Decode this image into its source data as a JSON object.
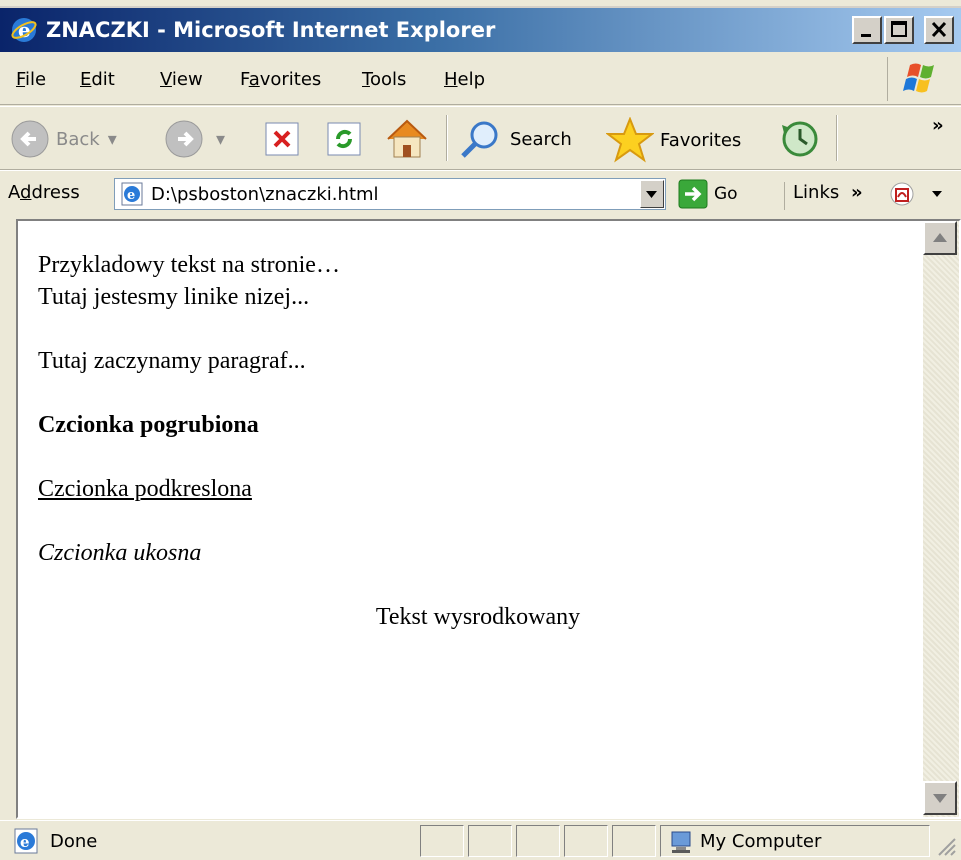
{
  "window": {
    "title": "ZNACZKI - Microsoft Internet Explorer"
  },
  "menu": {
    "items": [
      {
        "label_acc": "F",
        "label_rest": "ile"
      },
      {
        "label_acc": "E",
        "label_rest": "dit"
      },
      {
        "label_acc": "V",
        "label_rest": "iew"
      },
      {
        "label_pre": "F",
        "label_acc": "a",
        "label_rest": "vorites"
      },
      {
        "label_acc": "T",
        "label_rest": "ools"
      },
      {
        "label_acc": "H",
        "label_rest": "elp"
      }
    ]
  },
  "toolbar": {
    "back_label": "Back",
    "search_label": "Search",
    "favorites_label": "Favorites",
    "chevron": "»"
  },
  "address": {
    "label_pre": "A",
    "label_acc": "d",
    "label_rest": "dress",
    "value": "D:\\psboston\\znaczki.html",
    "go_label": "Go",
    "links_label": "Links",
    "links_chevron": "»"
  },
  "content": {
    "line1": "Przykladowy tekst na stronie…",
    "line2": "Tutaj jestesmy linike nizej...",
    "paragraph": "Tutaj zaczynamy paragraf...",
    "bold": "Czcionka pogrubiona",
    "underline": "Czcionka podkreslona",
    "italic": "Czcionka ukosna",
    "centered": "Tekst wysrodkowany"
  },
  "status": {
    "text": "Done",
    "zone": "My Computer"
  },
  "colors": {
    "title_gradient_start": "#0a246a",
    "title_gradient_end": "#a6caf0",
    "chrome": "#ece9d8"
  }
}
